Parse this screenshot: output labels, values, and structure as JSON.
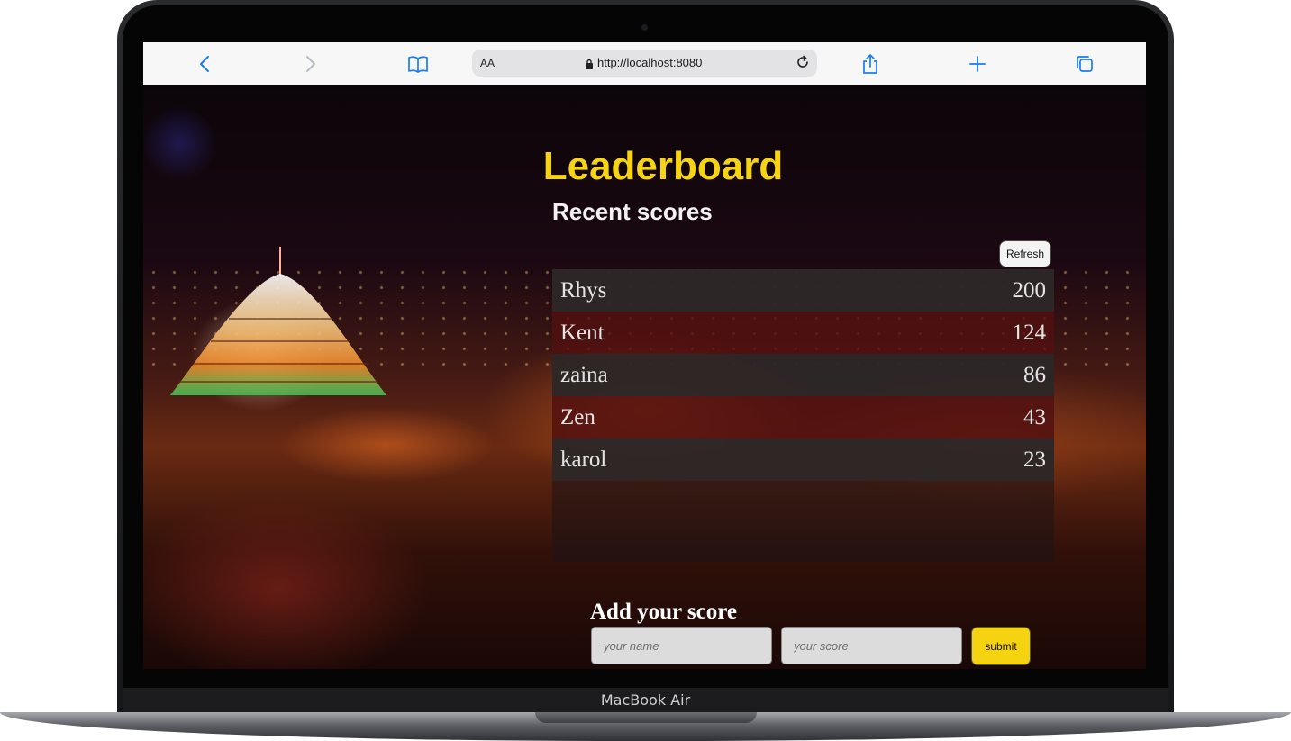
{
  "device": {
    "label": "MacBook Air"
  },
  "browser": {
    "text_size_label": "AA",
    "url": "http://localhost:8080"
  },
  "page": {
    "title": "Leaderboard",
    "recent_heading": "Recent scores",
    "refresh_label": "Refresh",
    "scores": [
      {
        "name": "Rhys",
        "score": "200"
      },
      {
        "name": "Kent",
        "score": "124"
      },
      {
        "name": "zaina",
        "score": "86"
      },
      {
        "name": "Zen",
        "score": "43"
      },
      {
        "name": "karol",
        "score": "23"
      }
    ],
    "form": {
      "heading": "Add your score",
      "name_placeholder": "your name",
      "score_placeholder": "your score",
      "submit_label": "submit"
    }
  },
  "colors": {
    "accent": "#f7d316",
    "browser_icon": "#1a7cf3",
    "row_dark": "#2e2828",
    "row_red": "#640e0e"
  }
}
